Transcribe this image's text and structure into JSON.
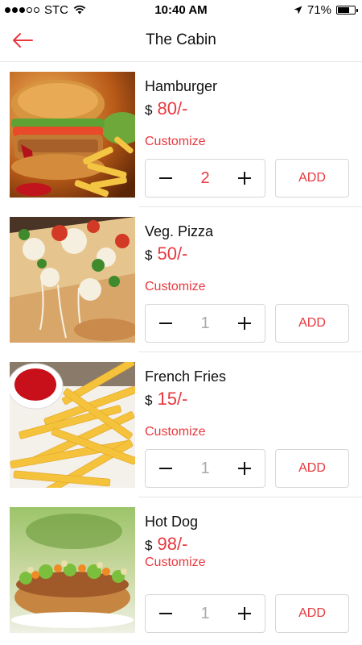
{
  "status_bar": {
    "carrier": "STC",
    "time": "10:40 AM",
    "battery": "71%",
    "battery_level": 0.71,
    "icons": [
      "signal-dots",
      "wifi-icon",
      "location-arrow-icon",
      "battery-icon"
    ]
  },
  "nav": {
    "title": "The Cabin",
    "back_icon": "back-arrow-icon"
  },
  "colors": {
    "accent": "#e8383e",
    "text": "#111111",
    "border": "#d6d6d6"
  },
  "items": [
    {
      "name": "Hamburger",
      "currency": "$",
      "price": "80/-",
      "customize": "Customize",
      "quantity": "2",
      "add_label": "ADD",
      "image": "hamburger-image"
    },
    {
      "name": "Veg. Pizza",
      "currency": "$",
      "price": "50/-",
      "customize": "Customize",
      "quantity": "1",
      "add_label": "ADD",
      "image": "pizza-image"
    },
    {
      "name": "French Fries",
      "currency": "$",
      "price": "15/-",
      "customize": "Customize",
      "quantity": "1",
      "add_label": "ADD",
      "image": "fries-image"
    },
    {
      "name": "Hot Dog",
      "currency": "$",
      "price": "98/-",
      "customize": "Customize",
      "quantity": "1",
      "add_label": "ADD",
      "image": "hotdog-image"
    }
  ]
}
